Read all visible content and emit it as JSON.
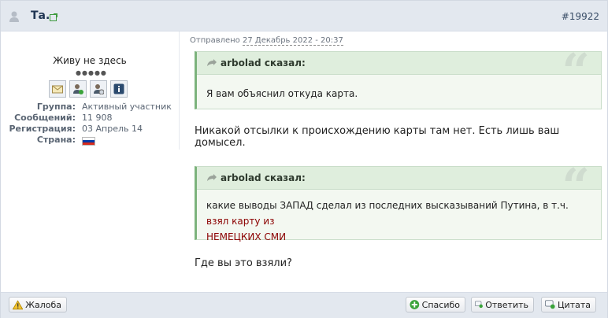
{
  "header": {
    "author": "Та.",
    "post_number": "#19922"
  },
  "profile": {
    "status": "Живу не здесь",
    "rating_pips": "●●●●●",
    "info": [
      {
        "label": "Группа:",
        "value": "Активный участник"
      },
      {
        "label": "Сообщений:",
        "value": "11 908"
      },
      {
        "label": "Регистрация:",
        "value": "03 Апрель 14"
      },
      {
        "label": "Страна:",
        "value": ""
      }
    ],
    "flag_colors": [
      "#ffffff",
      "#0039a6",
      "#d52b1e"
    ]
  },
  "post": {
    "posted_prefix": "Отправлено",
    "posted_date": "27 Декабрь 2022 - 20:37",
    "quote1": {
      "author": "arbolad сказал:",
      "text": "Я вам объяснил откуда карта."
    },
    "paragraph1": "Никакой отсылки к происхождению карты там нет. Есть лишь ваш домысел.",
    "quote2": {
      "author": "arbolad сказал:",
      "text_plain": "какие выводы ЗАПАД сделал из последних высказываний Путина, в т.ч. ",
      "text_red_1": "взял карту из",
      "text_red_2": "НЕМЕЦКИХ СМИ"
    },
    "paragraph2": "Где вы это взяли?"
  },
  "footer": {
    "report": "Жалоба",
    "thanks": "Спасибо",
    "reply": "Ответить",
    "quote": "Цитата"
  },
  "icons": {
    "user": "user-icon",
    "external": "external-link-icon",
    "quote": "quote-icon",
    "warning": "warning-icon",
    "thanks": "plus-icon",
    "reply": "reply-icon",
    "cite": "quote-reply-icon"
  }
}
